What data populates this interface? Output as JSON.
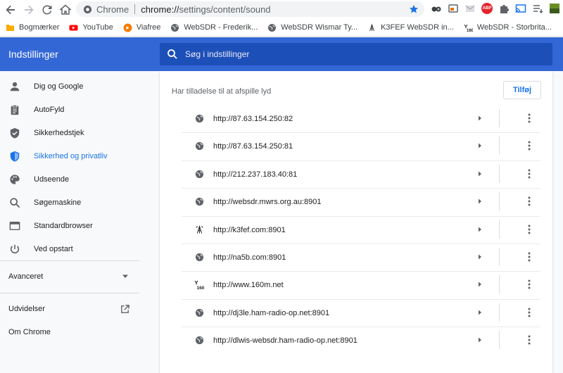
{
  "browser": {
    "omnibox": {
      "origin": "Chrome",
      "url_host": "chrome://",
      "url_path": "settings/content/sound"
    }
  },
  "bookmarks": [
    {
      "label": "Bogmærker",
      "icon": "folder-icon"
    },
    {
      "label": "YouTube",
      "icon": "youtube-icon"
    },
    {
      "label": "Viafree",
      "icon": "viafree-icon"
    },
    {
      "label": "WebSDR - Frederik...",
      "icon": "globe-icon"
    },
    {
      "label": "WebSDR Wismar Ty...",
      "icon": "globe-icon"
    },
    {
      "label": "K3FEF WebSDR in...",
      "icon": "antenna-icon"
    },
    {
      "label": "WebSDR - Storbrita...",
      "icon": "160m-icon"
    }
  ],
  "header": {
    "title": "Indstillinger",
    "search_placeholder": "Søg i indstillinger"
  },
  "sidebar": {
    "items": [
      {
        "label": "Dig og Google",
        "icon": "person-icon",
        "active": false
      },
      {
        "label": "AutoFyld",
        "icon": "clipboard-icon",
        "active": false
      },
      {
        "label": "Sikkerhedstjek",
        "icon": "shield-check-icon",
        "active": false
      },
      {
        "label": "Sikkerhed og privatliv",
        "icon": "shield-icon",
        "active": true
      },
      {
        "label": "Udseende",
        "icon": "palette-icon",
        "active": false
      },
      {
        "label": "Søgemaskine",
        "icon": "search-icon",
        "active": false
      },
      {
        "label": "Standardbrowser",
        "icon": "browser-icon",
        "active": false
      },
      {
        "label": "Ved opstart",
        "icon": "power-icon",
        "active": false
      }
    ],
    "advanced": "Avanceret",
    "extensions": "Udvidelser",
    "about": "Om Chrome"
  },
  "main": {
    "section_title": "Har tilladelse til at afspille lyd",
    "add_button": "Tilføj",
    "sites": [
      {
        "url": "http://87.63.154.250:82",
        "icon": "globe-icon"
      },
      {
        "url": "http://87.63.154.250:81",
        "icon": "globe-icon"
      },
      {
        "url": "http://212.237.183.40:81",
        "icon": "globe-icon"
      },
      {
        "url": "http://websdr.mwrs.org.au:8901",
        "icon": "globe-icon"
      },
      {
        "url": "http://k3fef.com:8901",
        "icon": "antenna-icon"
      },
      {
        "url": "http://na5b.com:8901",
        "icon": "globe-icon"
      },
      {
        "url": "http://www.160m.net",
        "icon": "160m-icon"
      },
      {
        "url": "http://dj3le.ham-radio-op.net:8901",
        "icon": "globe-icon"
      },
      {
        "url": "http://dlwis-websdr.ham-radio-op.net:8901",
        "icon": "globe-icon"
      }
    ]
  },
  "colors": {
    "header_bg": "#3367d6",
    "accent": "#1a73e8"
  }
}
